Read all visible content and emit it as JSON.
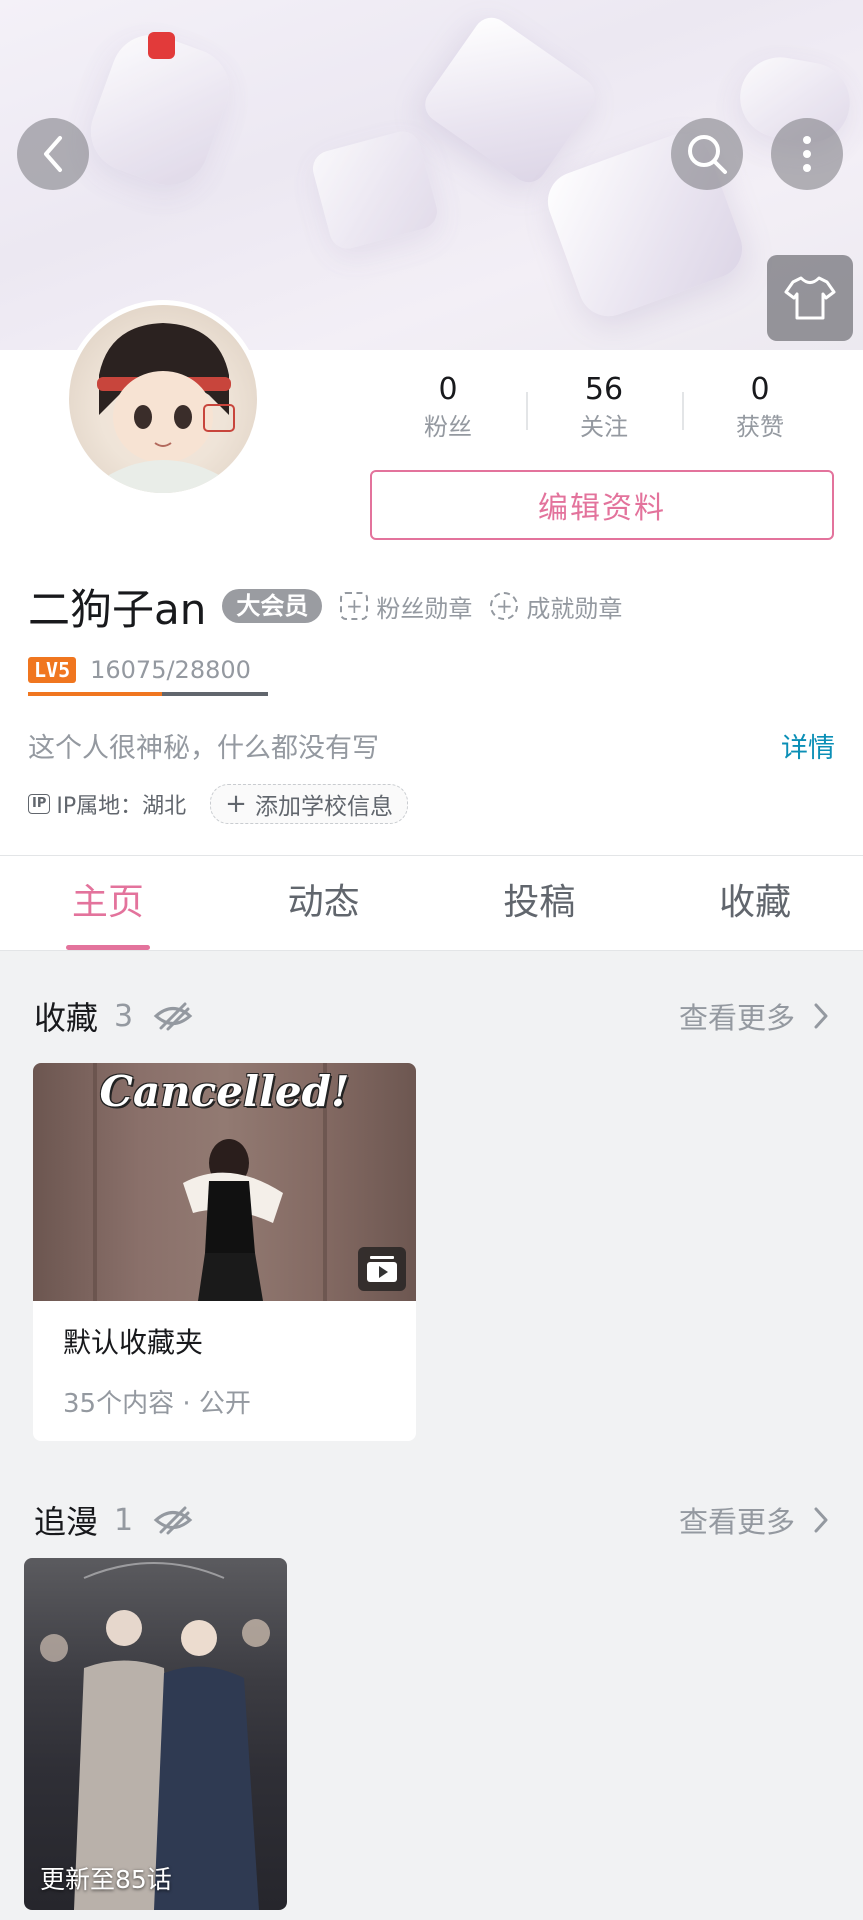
{
  "header": {
    "back_icon": "back-arrow-icon",
    "search_icon": "search-icon",
    "more_icon": "more-vertical-icon",
    "skin_icon": "tshirt-icon"
  },
  "profile": {
    "stats": [
      {
        "value": "0",
        "label": "粉丝"
      },
      {
        "value": "56",
        "label": "关注"
      },
      {
        "value": "0",
        "label": "获赞"
      }
    ],
    "edit_label": "编辑资料",
    "username": "二狗子an",
    "vip_label": "大会员",
    "fan_badge_label": "粉丝勋章",
    "achievement_badge_label": "成就勋章",
    "level_label": "LV5",
    "exp_text": "16075/28800",
    "exp_progress": 0.558,
    "bio": "这个人很神秘，什么都没有写",
    "detail_label": "详情",
    "ip_icon_label": "IP",
    "ip_location": "IP属地：湖北",
    "school_label": "添加学校信息"
  },
  "tabs": [
    {
      "label": "主页",
      "active": true
    },
    {
      "label": "动态",
      "active": false
    },
    {
      "label": "投稿",
      "active": false
    },
    {
      "label": "收藏",
      "active": false
    }
  ],
  "favorites": {
    "title": "收藏",
    "count": "3",
    "more_label": "查看更多",
    "folder": {
      "thumb_text": "Cancelled!",
      "name": "默认收藏夹",
      "meta": "35个内容 · 公开"
    }
  },
  "anime": {
    "title": "追漫",
    "count": "1",
    "more_label": "查看更多",
    "item": {
      "update_text": "更新至85话"
    }
  },
  "colors": {
    "accent_pink": "#e3739c",
    "link_blue": "#0b8fb6",
    "level_orange": "#f0761f"
  }
}
